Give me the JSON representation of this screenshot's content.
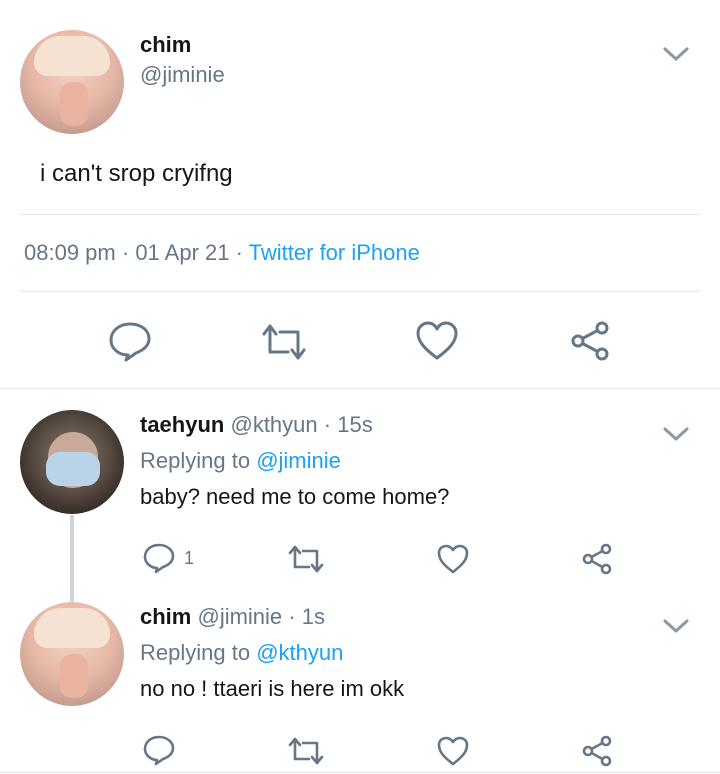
{
  "main_tweet": {
    "display_name": "chim",
    "handle": "@jiminie",
    "text": "i can't srop cryifng",
    "time": "08:09 pm",
    "sep1": "·",
    "date": "01 Apr 21",
    "sep2": "·",
    "source": "Twitter for iPhone"
  },
  "replies": [
    {
      "display_name": "taehyun",
      "handle": "@kthyun",
      "sep": "·",
      "age": "15s",
      "replying_prefix": "Replying to",
      "replying_to": "@jiminie",
      "text": "baby? need me to come home?",
      "reply_count": "1"
    },
    {
      "display_name": "chim",
      "handle": "@jiminie",
      "sep": "·",
      "age": "1s",
      "replying_prefix": "Replying to",
      "replying_to": "@kthyun",
      "text": "no no ! ttaeri is here im okk"
    }
  ],
  "colors": {
    "accent": "#1da1f2",
    "muted": "#657786",
    "divider": "#e1e8ed"
  },
  "icons": [
    "chevron-down-icon",
    "reply-icon",
    "retweet-icon",
    "like-icon",
    "share-icon"
  ]
}
